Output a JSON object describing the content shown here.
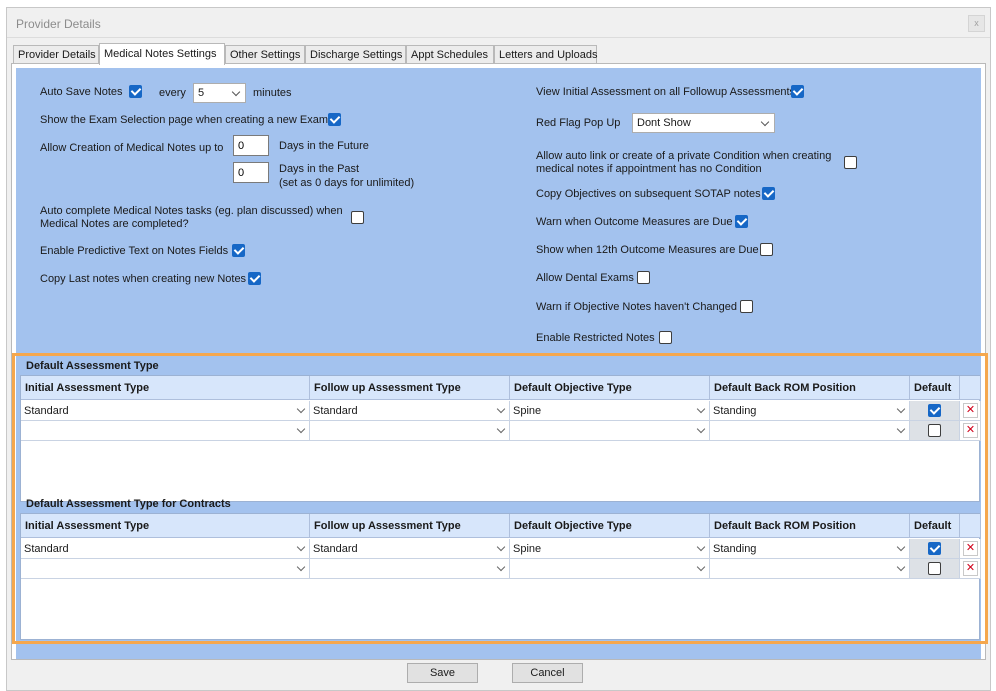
{
  "window": {
    "title": "Provider Details",
    "close": "x"
  },
  "tabs": [
    {
      "label": "Provider Details"
    },
    {
      "label": "Medical Notes Settings"
    },
    {
      "label": "Other Settings"
    },
    {
      "label": "Discharge Settings"
    },
    {
      "label": "Appt Schedules"
    },
    {
      "label": "Letters and Uploads"
    }
  ],
  "left": {
    "auto_save_label": "Auto Save Notes",
    "auto_save_checked": true,
    "every_label": "every",
    "every_value": "5",
    "minutes_label": "minutes",
    "exam_selection_label": "Show the Exam Selection page when creating a new Exam",
    "exam_selection_checked": true,
    "allow_creation_label": "Allow Creation of Medical Notes up to",
    "future_days_value": "0",
    "future_days_label": "Days in the Future",
    "past_days_value": "0",
    "past_days_label_1": "Days in the Past",
    "past_days_label_2": "(set as 0 days for unlimited)",
    "auto_complete_label_1": "Auto complete Medical Notes tasks (eg. plan discussed) when",
    "auto_complete_label_2": "Medical Notes are completed?",
    "auto_complete_checked": false,
    "predictive_label": "Enable Predictive Text on Notes Fields",
    "predictive_checked": true,
    "copy_last_label": "Copy Last notes when creating new Notes",
    "copy_last_checked": true
  },
  "right": {
    "view_initial_label": "View Initial Assessment on all Followup Assessments",
    "view_initial_checked": true,
    "red_flag_label": "Red Flag Pop Up",
    "red_flag_value": "Dont Show",
    "auto_link_label_1": "Allow auto link or create of a private Condition when creating",
    "auto_link_label_2": "medical notes if appointment has no Condition",
    "auto_link_checked": false,
    "copy_objectives_label": "Copy Objectives on subsequent SOTAP notes",
    "copy_objectives_checked": true,
    "warn_outcome_label": "Warn when Outcome Measures are Due",
    "warn_outcome_checked": true,
    "show_12th_label": "Show when 12th Outcome Measures are Due",
    "show_12th_checked": false,
    "dental_label": "Allow Dental Exams",
    "dental_checked": false,
    "warn_objective_label": "Warn if Objective Notes haven't Changed",
    "warn_objective_checked": false,
    "restricted_label": "Enable Restricted Notes",
    "restricted_checked": false
  },
  "grid1": {
    "title": "Default Assessment Type",
    "headers": [
      "Initial Assessment Type",
      "Follow up Assessment Type",
      "Default Objective Type",
      "Default Back ROM Position",
      "Default"
    ],
    "rows": [
      {
        "cells": [
          "Standard",
          "Standard",
          "Spine",
          "Standing"
        ],
        "default": true
      },
      {
        "cells": [
          "",
          "",
          "",
          ""
        ],
        "default": false
      }
    ]
  },
  "grid2": {
    "title": "Default Assessment Type for Contracts",
    "headers": [
      "Initial Assessment Type",
      "Follow up Assessment Type",
      "Default Objective Type",
      "Default Back ROM Position",
      "Default"
    ],
    "rows": [
      {
        "cells": [
          "Standard",
          "Standard",
          "Spine",
          "Standing"
        ],
        "default": true
      },
      {
        "cells": [
          "",
          "",
          "",
          ""
        ],
        "default": false
      }
    ]
  },
  "footer": {
    "save_label": "Save",
    "cancel_label": "Cancel"
  },
  "colors": {
    "panel": "#a3c2ee",
    "highlight": "#f5a74d",
    "check": "#1667c6",
    "delete": "#d0021b"
  }
}
